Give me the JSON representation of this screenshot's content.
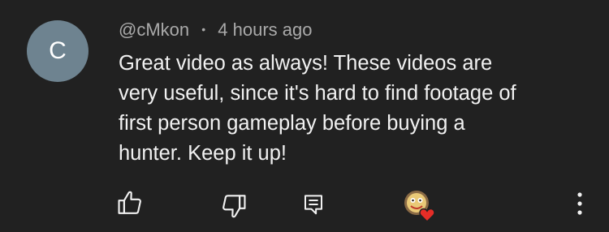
{
  "comment": {
    "avatar_letter": "C",
    "author": "@cMkon",
    "separator": "•",
    "timestamp": "4 hours ago",
    "text": "Great video as always! These videos are\nvery useful, since it's hard to find footage of\nfirst person gameplay before buying a\nhunter. Keep it up!"
  },
  "actions": {
    "icons": [
      "thumbs-up-icon",
      "thumbs-down-icon",
      "reply-icon",
      "creator-heart-icon",
      "more-vertical-icon"
    ]
  },
  "colors": {
    "background": "#212121",
    "avatar": "#6e8390",
    "text": "#f1f1f1",
    "meta": "#aaaaaa",
    "heart": "#e52d27"
  }
}
